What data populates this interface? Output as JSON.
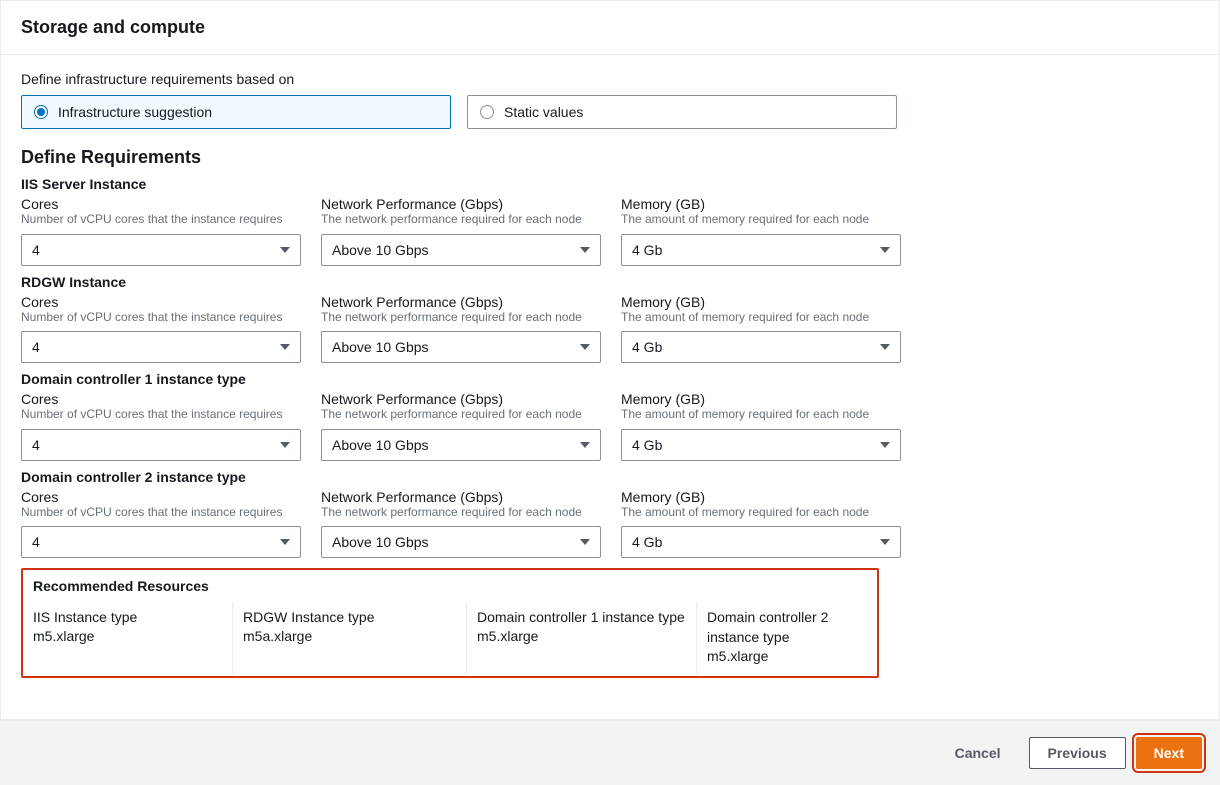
{
  "header": {
    "title": "Storage and compute"
  },
  "intro": "Define infrastructure requirements based on",
  "radios": {
    "suggestion": "Infrastructure suggestion",
    "static": "Static values"
  },
  "sectionTitle": "Define Requirements",
  "labels": {
    "cores": "Cores",
    "coresHint": "Number of vCPU cores that the instance requires",
    "net": "Network Performance (Gbps)",
    "netHint": "The network performance required for each node",
    "mem": "Memory (GB)",
    "memHint": "The amount of memory required for each node"
  },
  "groups": [
    {
      "title": "IIS Server Instance",
      "cores": "4",
      "net": "Above 10 Gbps",
      "mem": "4 Gb"
    },
    {
      "title": "RDGW Instance",
      "cores": "4",
      "net": "Above 10 Gbps",
      "mem": "4 Gb"
    },
    {
      "title": "Domain controller 1 instance type",
      "cores": "4",
      "net": "Above 10 Gbps",
      "mem": "4 Gb"
    },
    {
      "title": "Domain controller 2 instance type",
      "cores": "4",
      "net": "Above 10 Gbps",
      "mem": "4 Gb"
    }
  ],
  "recommended": {
    "title": "Recommended Resources",
    "cols": [
      {
        "label": "IIS Instance type",
        "value": "m5.xlarge"
      },
      {
        "label": "RDGW Instance type",
        "value": "m5a.xlarge"
      },
      {
        "label": "Domain controller 1 instance type",
        "value": "m5.xlarge"
      },
      {
        "label": "Domain controller 2 instance type",
        "value": "m5.xlarge"
      }
    ]
  },
  "footer": {
    "cancel": "Cancel",
    "previous": "Previous",
    "next": "Next"
  }
}
